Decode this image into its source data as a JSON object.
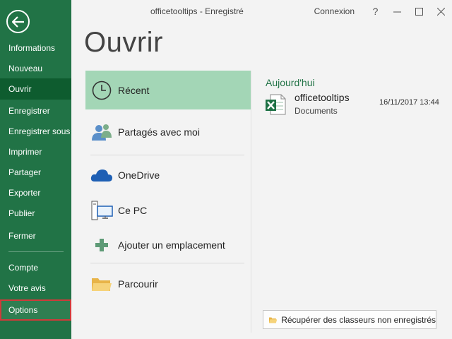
{
  "window": {
    "title": "officetooltips  -  Enregistré",
    "signin_label": "Connexion",
    "help_label": "?",
    "minimize_glyph": "—",
    "maximize_glyph": "☐",
    "close_glyph": "✕"
  },
  "sidebar": {
    "back_icon": "back-arrow-icon",
    "items": [
      {
        "label": "Informations"
      },
      {
        "label": "Nouveau"
      },
      {
        "label": "Ouvrir",
        "active": true
      },
      {
        "label": "Enregistrer"
      },
      {
        "label": "Enregistrer sous"
      },
      {
        "label": "Imprimer"
      },
      {
        "label": "Partager"
      },
      {
        "label": "Exporter"
      },
      {
        "label": "Publier"
      },
      {
        "label": "Fermer"
      },
      {
        "label": "Compte"
      },
      {
        "label": "Votre avis"
      },
      {
        "label": "Options",
        "highlighted": true
      }
    ]
  },
  "main": {
    "title": "Ouvrir",
    "locations": [
      {
        "label": "Récent",
        "icon": "clock-icon",
        "selected": true
      },
      {
        "label": "Partagés avec moi",
        "icon": "people-icon"
      },
      {
        "label": "OneDrive",
        "icon": "cloud-icon"
      },
      {
        "label": "Ce PC",
        "icon": "computer-icon"
      },
      {
        "label": "Ajouter un emplacement",
        "icon": "plus-icon"
      },
      {
        "label": "Parcourir",
        "icon": "folder-icon"
      }
    ],
    "recent": {
      "group_label": "Aujourd'hui",
      "files": [
        {
          "name": "officetooltips",
          "path": "Documents",
          "date": "16/11/2017 13:44",
          "icon": "excel-file-icon"
        }
      ]
    },
    "recover_label": "Récupérer des classeurs non enregistrés"
  },
  "colors": {
    "sidebar_bg": "#217346",
    "sidebar_active": "#0e5c2f",
    "selected_location": "#a3d6b6",
    "accent_green": "#217346",
    "highlight_border": "#d03a3a"
  }
}
